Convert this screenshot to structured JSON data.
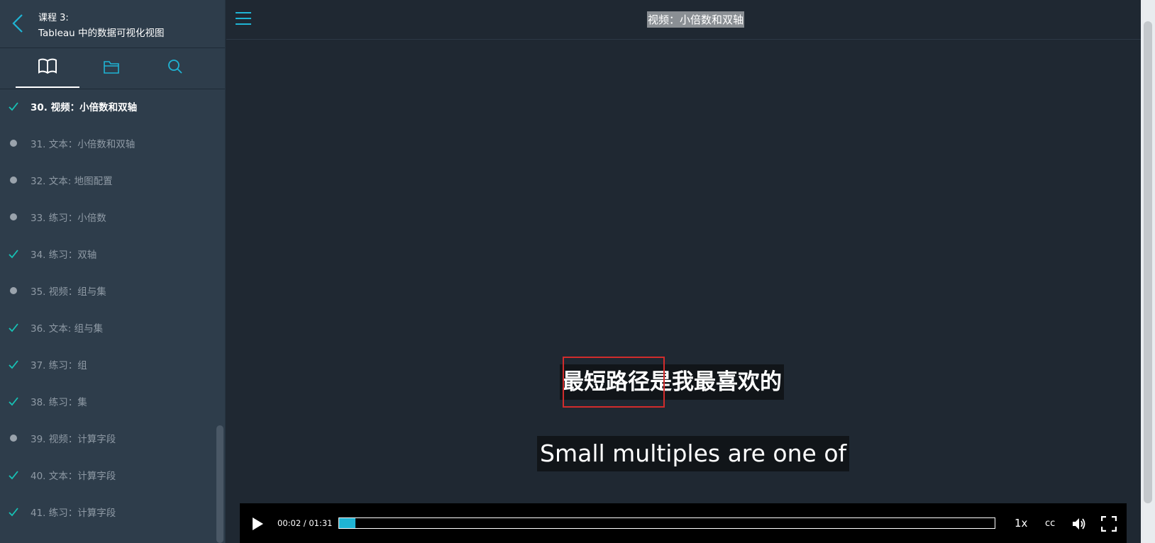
{
  "sidebar": {
    "course_number": "课程 3:",
    "course_title": "Tableau 中的数据可视化视图",
    "tabs": [
      "lessons",
      "resources",
      "search"
    ],
    "items": [
      {
        "label": "30. 视频：小倍数和双轴",
        "status": "done",
        "current": true
      },
      {
        "label": "31. 文本：小倍数和双轴",
        "status": "todo"
      },
      {
        "label": "32. 文本: 地图配置",
        "status": "todo"
      },
      {
        "label": "33. 练习：小倍数",
        "status": "todo"
      },
      {
        "label": "34. 练习：双轴",
        "status": "done"
      },
      {
        "label": "35. 视频：组与集",
        "status": "todo"
      },
      {
        "label": "36. 文本: 组与集",
        "status": "done"
      },
      {
        "label": "37. 练习：组",
        "status": "done"
      },
      {
        "label": "38. 练习：集",
        "status": "done"
      },
      {
        "label": "39. 视频：计算字段",
        "status": "todo"
      },
      {
        "label": "40. 文本：计算字段",
        "status": "done"
      },
      {
        "label": "41. 练习：计算字段",
        "status": "done"
      }
    ]
  },
  "header": {
    "title": "视频：小倍数和双轴"
  },
  "video": {
    "subtitle_cn": "最短路径是我最喜欢的",
    "subtitle_en": "Small multiples are one of",
    "time": "00:02 / 01:31",
    "progress": 0.025,
    "speed": "1x",
    "cc": "cc"
  },
  "colors": {
    "accent": "#1fb4d4",
    "check": "#17c2b5",
    "sidebar_bg": "#2e3d4b",
    "main_bg": "#1f2832"
  }
}
